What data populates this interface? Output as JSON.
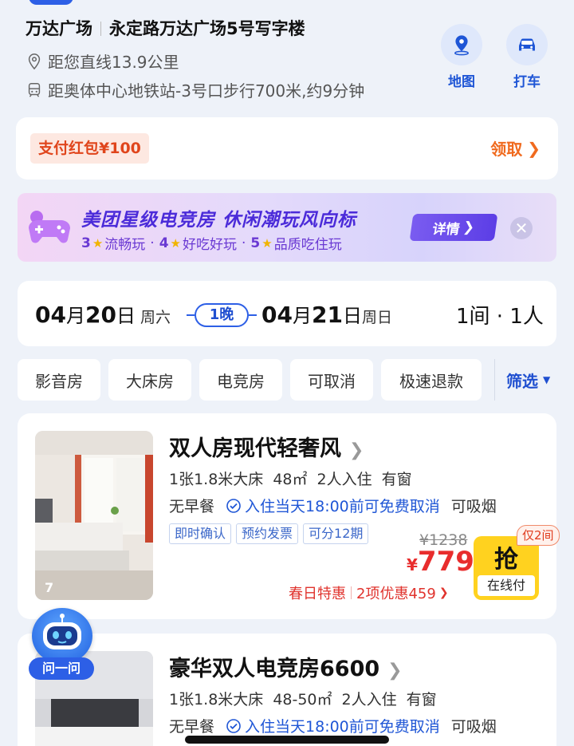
{
  "header": {
    "plaza": "万达广场",
    "address": "永定路万达广场5号写字楼",
    "distance": "距您直线13.9公里",
    "metro": "距奥体中心地铁站-3号口步行700米,约9分钟",
    "map_label": "地图",
    "taxi_label": "打车"
  },
  "coupon": {
    "badge": "支付红包¥100",
    "claim": "领取"
  },
  "promo": {
    "title": "美团星级电竞房  休闲潮玩风向标",
    "items": [
      {
        "num": "3",
        "text": "流畅玩"
      },
      {
        "num": "4",
        "text": "好吃好玩"
      },
      {
        "num": "5",
        "text": "品质吃住玩"
      }
    ],
    "detail": "详情"
  },
  "dates": {
    "checkin_month": "04",
    "checkin_day": "20",
    "checkin_weekday": "周六",
    "nights": "1晚",
    "checkout_month": "04",
    "checkout_day": "21",
    "checkout_weekday": "周日",
    "rooms_guests": "1间 · 1人",
    "month_unit": "月",
    "day_unit": "日"
  },
  "filters": {
    "chips": [
      "影音房",
      "大床房",
      "电竞房",
      "可取消",
      "极速退款"
    ],
    "more": "筛选"
  },
  "rooms": [
    {
      "title": "双人房现代轻奢风",
      "bed": "1张1.8米大床",
      "area": "48㎡",
      "guests": "2人入住",
      "window": "有窗",
      "breakfast": "无早餐",
      "cancel": "入住当天18:00前可免费取消",
      "smoking": "可吸烟",
      "tags": [
        "即时确认",
        "预约发票",
        "可分12期"
      ],
      "image_count": "7",
      "orig_price": "¥1238",
      "currency": "¥",
      "price": "779",
      "only_left": "仅2间",
      "grab": "抢",
      "pay_online": "在线付",
      "deal": "春日特惠",
      "discount": "2项优惠459"
    },
    {
      "title": "豪华双人电竞房6600",
      "bed": "1张1.8米大床",
      "area": "48-50㎡",
      "guests": "2人入住",
      "window": "有窗",
      "breakfast": "无早餐",
      "cancel": "入住当天18:00前可免费取消",
      "smoking": "可吸烟"
    }
  ],
  "assistant": {
    "label": "问一问"
  }
}
